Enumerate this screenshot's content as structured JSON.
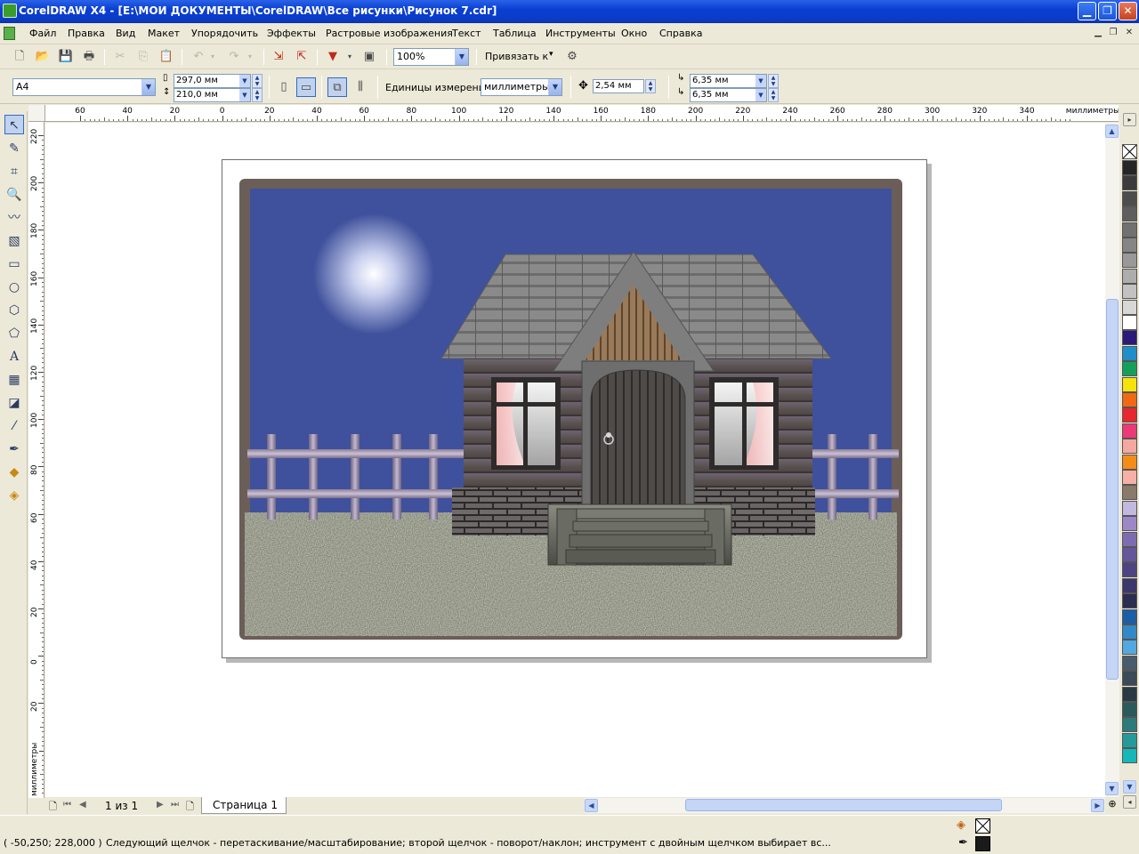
{
  "window": {
    "title": "CorelDRAW X4 - [E:\\МОИ ДОКУМЕНТЫ\\CorelDRAW\\Все рисунки\\Рисунок 7.cdr]",
    "minimize": "▁",
    "restore": "❐",
    "close": "✕"
  },
  "menu": [
    "Файл",
    "Правка",
    "Вид",
    "Макет",
    "Упорядочить",
    "Эффекты",
    "Растровые изображения",
    "Текст",
    "Таблица",
    "Инструменты",
    "Окно",
    "Справка"
  ],
  "mdi": {
    "minimize": "▁",
    "restore": "❐",
    "close": "✕"
  },
  "standard_toolbar": {
    "icons": [
      "new-icon",
      "open-icon",
      "save-icon",
      "print-icon",
      "cut-icon",
      "copy-icon",
      "paste-icon",
      "undo-icon",
      "redo-icon",
      "import-icon",
      "export-icon",
      "application-launcher-icon",
      "welcome-screen-icon"
    ],
    "zoom_value": "100%",
    "snap_label": "Привязать к",
    "snap_arrow": "▾"
  },
  "property_bar": {
    "paper_type": "A4",
    "width": "297,0 мм",
    "height": "210,0 мм",
    "units_label": "Единицы измерения:",
    "units_value": "миллиметры",
    "nudge": "2,54 мм",
    "dup_x": "6,35 мм",
    "dup_y": "6,35 мм"
  },
  "toolbox": [
    "pick-tool-icon",
    "shape-tool-icon",
    "crop-tool-icon",
    "zoom-tool-icon",
    "freehand-tool-icon",
    "smart-fill-tool-icon",
    "rectangle-tool-icon",
    "ellipse-tool-icon",
    "polygon-tool-icon",
    "basic-shapes-tool-icon",
    "text-tool-icon",
    "table-tool-icon",
    "interactive-effects-tool-icon",
    "eyedropper-tool-icon",
    "outline-tool-icon",
    "fill-tool-icon",
    "interactive-fill-tool-icon"
  ],
  "rulers": {
    "h_ticks": [
      "60",
      "40",
      "20",
      "0",
      "20",
      "40",
      "60",
      "80",
      "100",
      "120",
      "140",
      "160",
      "180",
      "200",
      "220",
      "240",
      "260",
      "280",
      "300",
      "320",
      "340"
    ],
    "h_unit": "миллиметры",
    "v_ticks": [
      "220",
      "200",
      "180",
      "160",
      "140",
      "120",
      "100",
      "80",
      "60",
      "40",
      "20",
      "0",
      "20",
      "40"
    ],
    "v_unit": "миллиметры"
  },
  "page_nav": {
    "count": "1 из 1",
    "tab": "Страница 1"
  },
  "palette": [
    "#262626",
    "#3b3b3b",
    "#4d4d4d",
    "#5e5e5e",
    "#717171",
    "#858585",
    "#999999",
    "#adadad",
    "#c2c2c2",
    "#d7d7d7",
    "#ffffff",
    "#2b1a78",
    "#1d8ec8",
    "#14a05a",
    "#f5e40b",
    "#f06a14",
    "#e8262d",
    "#ec3a78",
    "#f5a7a0",
    "#f58c18",
    "#f6b0a8",
    "#8a7a6a",
    "#c2b8e0",
    "#9c88c8",
    "#7e6cb2",
    "#64569a",
    "#4e4482",
    "#3c386a",
    "#2b2e50",
    "#1b5ea6",
    "#3388c8",
    "#54a8e0",
    "#485c6c",
    "#3a4a56",
    "#2a3a44",
    "#2a5a5a",
    "#2c7a7a",
    "#259a9a",
    "#15b8b8"
  ],
  "status": {
    "coords": "( -50,250; 228,000 )",
    "message": "Следующий щелчок - перетаскивание/масштабирование; второй щелчок - поворот/наклон; инструмент с двойным щелчком выбирает вс..."
  }
}
